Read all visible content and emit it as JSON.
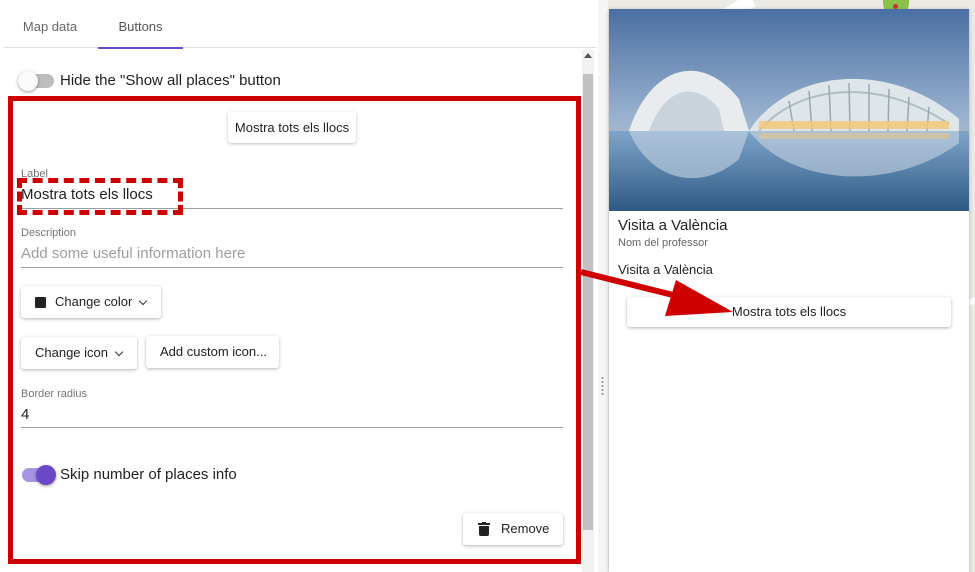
{
  "tabs": [
    {
      "label": "Map data",
      "active": false
    },
    {
      "label": "Buttons",
      "active": true
    }
  ],
  "hide_show_all": {
    "label": "Hide the \"Show all places\" button",
    "checked": false
  },
  "preview_button": {
    "label": "Mostra tots els llocs"
  },
  "label_field": {
    "label": "Label",
    "value": "Mostra tots els llocs"
  },
  "description_field": {
    "label": "Description",
    "placeholder": "Add some useful information here",
    "value": ""
  },
  "change_color": {
    "label": "Change color",
    "color": "#222222"
  },
  "change_icon": {
    "label": "Change icon"
  },
  "add_custom_icon": {
    "label": "Add custom icon..."
  },
  "border_radius_field": {
    "label": "Border radius",
    "value": "4"
  },
  "skip_places": {
    "label": "Skip number of places info",
    "checked": true
  },
  "remove_button": {
    "label": "Remove"
  },
  "preview_card": {
    "title": "Visita a València",
    "subtitle": "Nom del professor",
    "description": "Visita a València",
    "button_label": "Mostra tots els llocs"
  },
  "colors": {
    "accent": "#6a48c7",
    "annotation": "#cf0000"
  }
}
